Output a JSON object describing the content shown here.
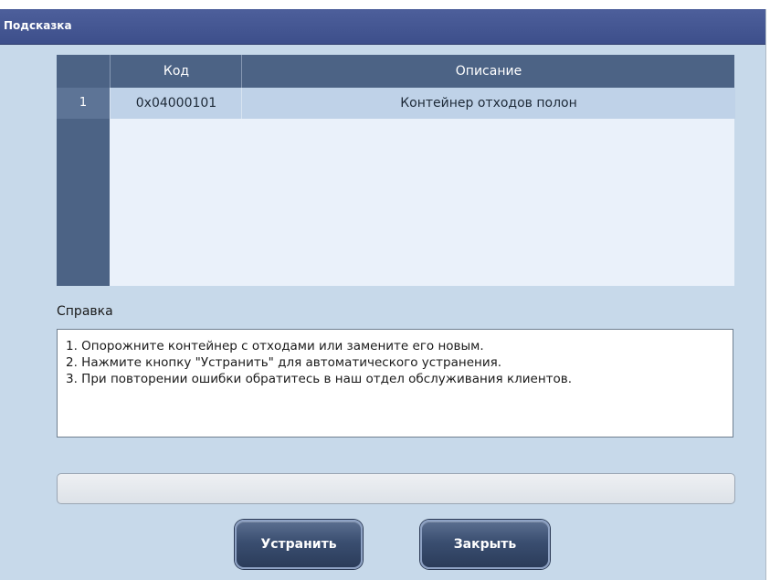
{
  "window": {
    "title": "Подсказка"
  },
  "table": {
    "columns": [
      "",
      "Код",
      "Описание"
    ],
    "rows": [
      {
        "index": "1",
        "code": "0x04000101",
        "description": "Контейнер отходов полон"
      }
    ]
  },
  "help": {
    "label": "Справка",
    "lines": [
      "1. Опорожните контейнер с отходами или замените его новым.",
      "2. Нажмите кнопку \"Устранить\" для автоматического устранения.",
      "3. При повторении ошибки обратитесь в наш отдел обслуживания клиентов."
    ]
  },
  "status": {
    "text": ""
  },
  "buttons": {
    "fix_label": "Устранить",
    "close_label": "Закрыть"
  },
  "colors": {
    "titlebar": "#3d4f8b",
    "background": "#c7d9ea",
    "table_header": "#4c6385",
    "selected_row": "#bfd2e8"
  }
}
